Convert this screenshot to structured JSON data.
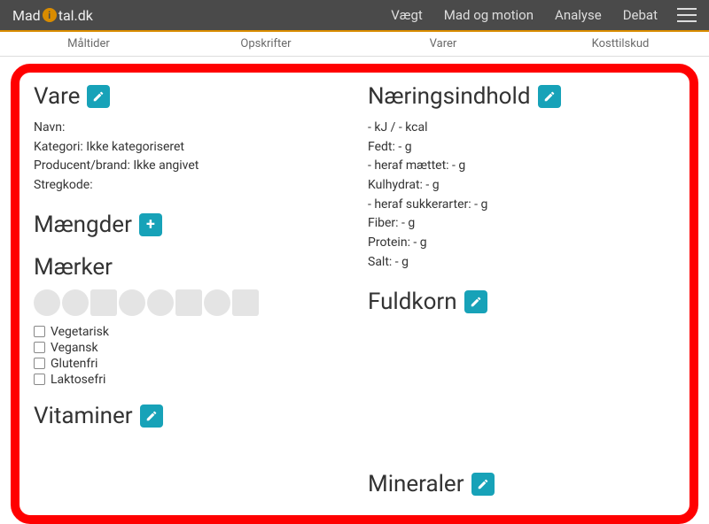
{
  "brand": {
    "pre": "Mad",
    "post": "tal.dk"
  },
  "topnav": {
    "items": [
      "Vægt",
      "Mad og motion",
      "Analyse",
      "Debat"
    ]
  },
  "subtabs": {
    "items": [
      "Måltider",
      "Opskrifter",
      "Varer",
      "Kosttilskud"
    ]
  },
  "vare": {
    "heading": "Vare",
    "lines": {
      "navn_label": "Navn:",
      "kategori": "Kategori: Ikke kategoriseret",
      "producent": "Producent/brand: Ikke angivet",
      "stregkode_label": "Stregkode:"
    }
  },
  "maengder": {
    "heading": "Mængder"
  },
  "maerker": {
    "heading": "Mærker",
    "options": [
      "Vegetarisk",
      "Vegansk",
      "Glutenfri",
      "Laktosefri"
    ]
  },
  "vitaminer": {
    "heading": "Vitaminer"
  },
  "naering": {
    "heading": "Næringsindhold",
    "lines": {
      "energy": "- kJ / - kcal",
      "fat": "Fedt: - g",
      "sat": "- heraf mættet: - g",
      "carb": "Kulhydrat: - g",
      "sugar": "- heraf sukkerarter: - g",
      "fiber": "Fiber: - g",
      "protein": "Protein: - g",
      "salt": "Salt: - g"
    }
  },
  "fuldkorn": {
    "heading": "Fuldkorn"
  },
  "mineraler": {
    "heading": "Mineraler"
  },
  "colors": {
    "accent": "#17a2b8",
    "topbar": "#4a4a4a",
    "brand_orange": "#d98c00",
    "annotation_red": "#ff0000"
  }
}
